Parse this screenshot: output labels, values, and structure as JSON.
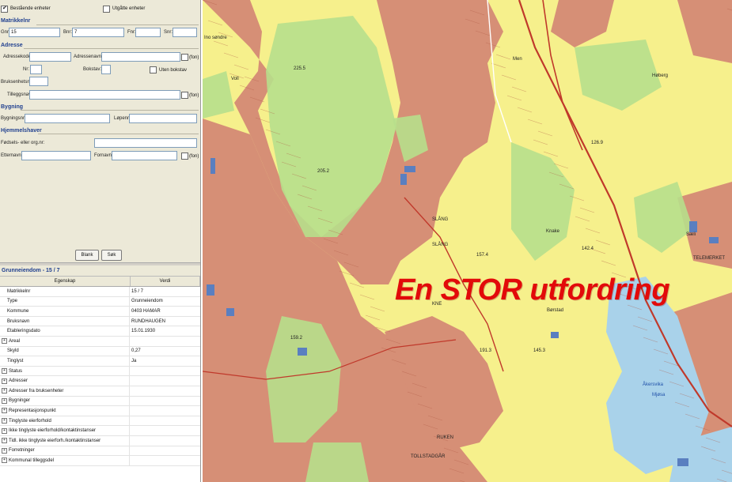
{
  "search": {
    "checkbox_existing": "Bestående enheter",
    "checkbox_expired": "Utgåtte enheter",
    "sections": {
      "matrikkelnr": "Matrikkelnr",
      "adresse": "Adresse",
      "bygning": "Bygning",
      "hjemmelshaver": "Hjemmelshaver"
    },
    "matrikkel": {
      "gnr_label": "Gnr:",
      "gnr_value": "15",
      "bnr_label": "Bnr:",
      "bnr_value": "7",
      "fnr_label": "Fnr:",
      "fnr_value": "",
      "snr_label": "Snr:",
      "snr_value": ""
    },
    "adresse": {
      "adressekode_label": "Adressekode:",
      "adressenavn_label": "Adressenavn:",
      "fon": "(fon)",
      "nr_label": "Nr:",
      "bokstav_label": "Bokstav:",
      "uten_bokstav_label": "Uten bokstav",
      "bruksenhetsnr_label": "Bruksenhetsnr:",
      "tilleggsnavn_label": "Tilleggsnavn:"
    },
    "bygning": {
      "bygningsnr_label": "Bygningsnr:",
      "lopenr_label": "Løpenr:"
    },
    "hjemmelshaver": {
      "fodsels_label": "Fødsels- eller org.nr:",
      "etternavn_label": "Etternavn:",
      "fornavn_label": "Fornavn:",
      "fon": "(fon)"
    },
    "buttons": {
      "clear": "Blank",
      "search": "Søk"
    }
  },
  "properties": {
    "title": "Grunneiendom - 15 / 7",
    "col_property": "Egenskap",
    "col_value": "Verdi",
    "rows": [
      {
        "name": "Matrikkelnr",
        "value": "15 / 7",
        "expandable": false
      },
      {
        "name": "Type",
        "value": "Grunneiendom",
        "expandable": false
      },
      {
        "name": "Kommune",
        "value": "0403 HAMAR",
        "expandable": false
      },
      {
        "name": "Bruksnavn",
        "value": "RUNDHAUGEN",
        "expandable": false
      },
      {
        "name": "Etableringsdato",
        "value": "15.01.1930",
        "expandable": false
      },
      {
        "name": "Areal",
        "value": "",
        "expandable": true
      },
      {
        "name": "Skyld",
        "value": "0,27",
        "expandable": false
      },
      {
        "name": "Tinglyst",
        "value": "Ja",
        "expandable": false
      },
      {
        "name": "Status",
        "value": "",
        "expandable": true
      },
      {
        "name": "Adresser",
        "value": "",
        "expandable": true
      },
      {
        "name": "Adresser fra bruksenheter",
        "value": "",
        "expandable": true
      },
      {
        "name": "Bygninger",
        "value": "",
        "expandable": true
      },
      {
        "name": "Representasjonspunkt",
        "value": "",
        "expandable": true
      },
      {
        "name": "Tinglyste eierforhold",
        "value": "",
        "expandable": true
      },
      {
        "name": "Ikke tinglyste eierforhold/kontaktinstanser",
        "value": "",
        "expandable": true
      },
      {
        "name": "Tidl. ikke tinglyste eierforh./kontaktinstanser",
        "value": "",
        "expandable": true
      },
      {
        "name": "Forretninger",
        "value": "",
        "expandable": true
      },
      {
        "name": "Kommunal tilleggsdel",
        "value": "",
        "expandable": true
      }
    ]
  },
  "map": {
    "overlay_text": "En STOR utfordring",
    "labels": {
      "sondre": "Ino søndre",
      "voll": "Voll",
      "men": "Men",
      "hoberg": "Høberg",
      "saelid": "Sæli",
      "telemarket": "TELEMERKET",
      "akersvika": "Åkersvika",
      "mjosa": "Mjøsa",
      "borstad": "Børstad",
      "knake": "Knake",
      "sl": "SLÅNG",
      "sl2": "SLÅNG",
      "e225": "225.5",
      "e205": "205.2",
      "e159": "159.2",
      "e157": "157.4",
      "e142": "142.4",
      "e126": "126.9",
      "e1913": "191.3",
      "e1453": "145.3",
      "sk": "KNE",
      "ruk": "RUKEN",
      "tollstad": "TOLLSTADGÅR"
    },
    "colors": {
      "residential": "#d68f76",
      "forest": "#b7df8c",
      "field": "#f6f08c",
      "water": "#a9d2ea",
      "road": "#c0392b",
      "overlay": "#e20a0a"
    }
  }
}
